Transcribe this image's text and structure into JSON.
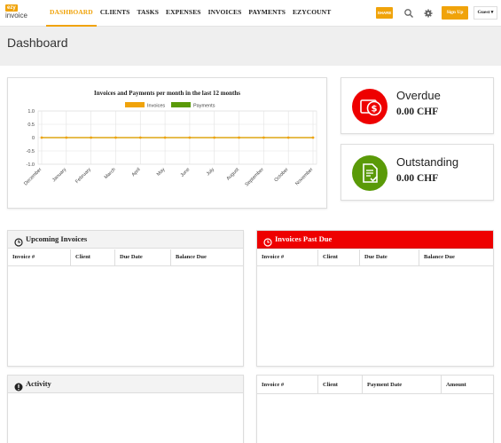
{
  "nav": {
    "logo_top": "ezy",
    "logo_bottom": "invoice",
    "items": [
      {
        "label": "DASHBOARD",
        "active": true
      },
      {
        "label": "CLIENTS"
      },
      {
        "label": "TASKS"
      },
      {
        "label": "EXPENSES"
      },
      {
        "label": "INVOICES"
      },
      {
        "label": "PAYMENTS"
      },
      {
        "label": "EZYCOUNT"
      }
    ],
    "share_label": "SHARE",
    "search_icon": "search-icon",
    "settings_icon": "gear-icon",
    "signup_label": "Sign Up",
    "guest_label": "Guest ▾"
  },
  "page": {
    "title": "Dashboard"
  },
  "chart_data": {
    "type": "line",
    "title": "Invoices and Payments per month in the last 12 months",
    "categories": [
      "December",
      "January",
      "February",
      "March",
      "April",
      "May",
      "June",
      "July",
      "August",
      "September",
      "October",
      "November"
    ],
    "series": [
      {
        "name": "Invoices",
        "color": "#f0a30a",
        "values": [
          0,
          0,
          0,
          0,
          0,
          0,
          0,
          0,
          0,
          0,
          0,
          0
        ]
      },
      {
        "name": "Payments",
        "color": "#5a9a08",
        "values": [
          0,
          0,
          0,
          0,
          0,
          0,
          0,
          0,
          0,
          0,
          0,
          0
        ]
      }
    ],
    "ylim": [
      -1.0,
      1.0
    ],
    "yticks": [
      "1.0",
      "0.5",
      "0",
      "-0.5",
      "-1.0"
    ],
    "grid": true,
    "legend": "top"
  },
  "overdue": {
    "label": "Overdue",
    "value": "0.00 CHF",
    "color": "#ee0000",
    "icon": "money-icon"
  },
  "outstanding": {
    "label": "Outstanding",
    "value": "0.00 CHF",
    "color": "#5a9a08",
    "icon": "document-icon"
  },
  "upcoming": {
    "title": "Upcoming Invoices",
    "icon": "clock-icon",
    "columns": [
      "Invoice #",
      "Client",
      "Due Date",
      "Balance Due"
    ]
  },
  "pastdue": {
    "title": "Invoices Past Due",
    "icon": "clock-icon",
    "color": "#ee0000",
    "columns": [
      "Invoice #",
      "Client",
      "Due Date",
      "Balance Due"
    ]
  },
  "activity": {
    "title": "Activity",
    "icon": "exclamation-icon"
  },
  "payments": {
    "columns": [
      "Invoice #",
      "Client",
      "Payment Date",
      "Amount"
    ]
  }
}
